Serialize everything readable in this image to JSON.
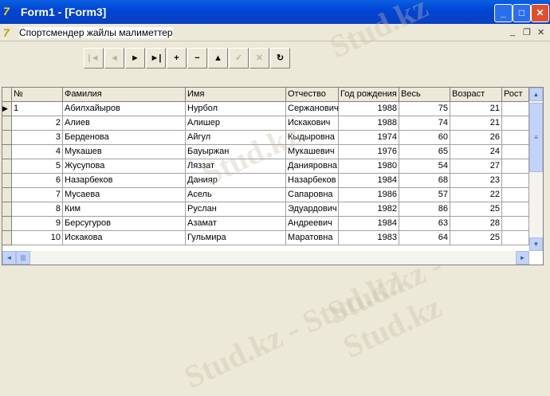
{
  "window": {
    "title": "Form1 - [Form3]"
  },
  "mdi": {
    "caption": "Спортсмендер жайлы малиметтер"
  },
  "toolbar": [
    {
      "name": "first",
      "glyph": "|◄",
      "enabled": false
    },
    {
      "name": "prior",
      "glyph": "◄",
      "enabled": false
    },
    {
      "name": "next",
      "glyph": "►",
      "enabled": true
    },
    {
      "name": "last",
      "glyph": "►|",
      "enabled": true
    },
    {
      "name": "insert",
      "glyph": "+",
      "enabled": true
    },
    {
      "name": "delete",
      "glyph": "−",
      "enabled": true
    },
    {
      "name": "edit",
      "glyph": "▲",
      "enabled": true
    },
    {
      "name": "post",
      "glyph": "✓",
      "enabled": false
    },
    {
      "name": "cancel",
      "glyph": "✕",
      "enabled": false
    },
    {
      "name": "refresh",
      "glyph": "↻",
      "enabled": true
    }
  ],
  "columns": [
    "№",
    "Фамилия",
    "Имя",
    "Отчество",
    "Год рождения",
    "Весь",
    "Возраст",
    "Рост"
  ],
  "rows": [
    [
      "1",
      "Абилхайыров",
      "Нурбол",
      "Сержанович",
      "1988",
      "75",
      "21",
      ""
    ],
    [
      "2",
      "Алиев",
      "Алишер",
      "Искакович",
      "1988",
      "74",
      "21",
      ""
    ],
    [
      "3",
      "Берденова",
      "Айгул",
      "Кыдыровна",
      "1974",
      "60",
      "26",
      ""
    ],
    [
      "4",
      "Мукашев",
      "Бауыржан",
      "Мукашевич",
      "1976",
      "65",
      "24",
      ""
    ],
    [
      "5",
      "Жусупова",
      "Ляззат",
      "Данияровна",
      "1980",
      "54",
      "27",
      ""
    ],
    [
      "6",
      "Назарбеков",
      "Данияр",
      "Назарбеков",
      "1984",
      "68",
      "23",
      ""
    ],
    [
      "7",
      "Мусаева",
      "Асель",
      "Сапаровна",
      "1986",
      "57",
      "22",
      ""
    ],
    [
      "8",
      "Ким",
      "Руслан",
      "Эдуардович",
      "1982",
      "86",
      "25",
      ""
    ],
    [
      "9",
      "Берсугуров",
      "Азамат",
      "Андреевич",
      "1984",
      "63",
      "28",
      ""
    ],
    [
      "10",
      "Искакова",
      "Гульмира",
      "Маратовна",
      "1983",
      "64",
      "25",
      ""
    ]
  ],
  "watermark": "Stud.kz"
}
